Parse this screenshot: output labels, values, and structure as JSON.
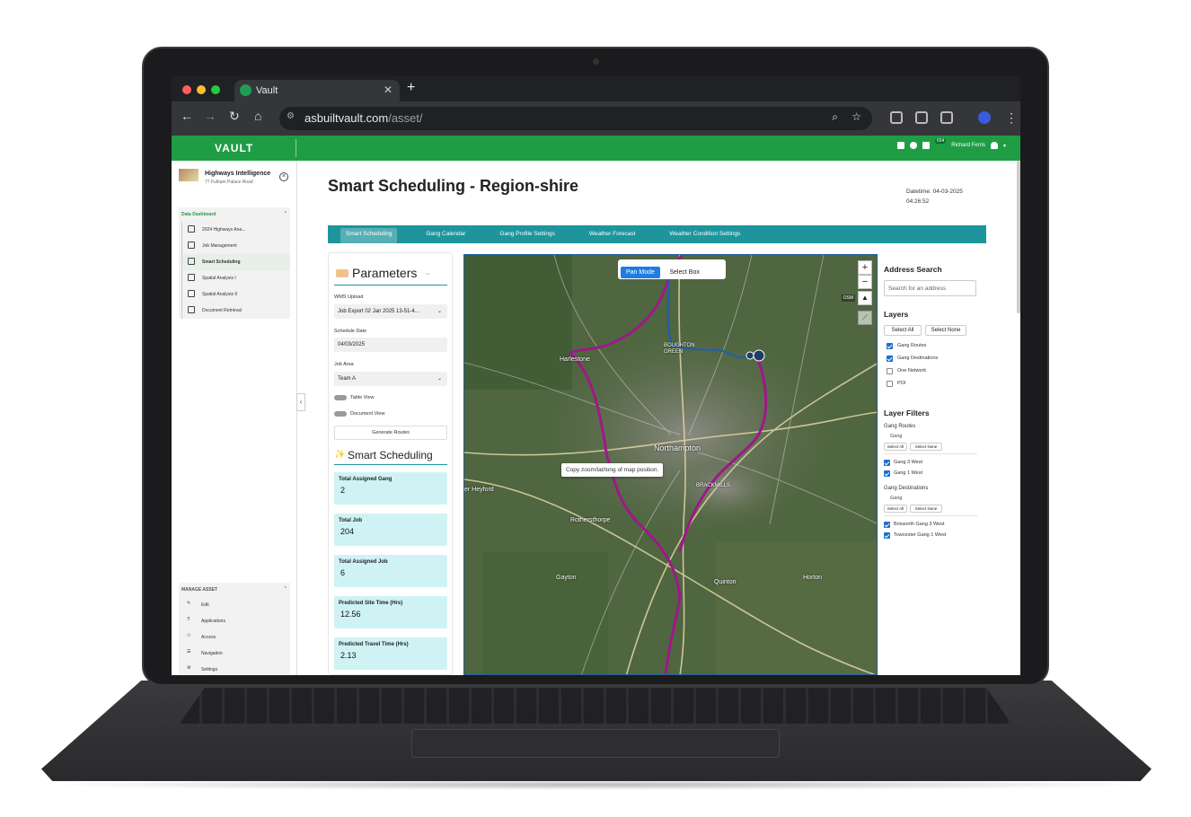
{
  "browser": {
    "tab_title": "Vault",
    "url_host": "asbuiltvault.com",
    "url_path": "/asset/",
    "new_tab_symbol": "+",
    "close_symbol": "✕"
  },
  "app": {
    "logo": "VAULT",
    "notification_count": "654",
    "user_name": "Richard Ferris"
  },
  "sidebar": {
    "project_title": "Highways Intelligence",
    "project_address": "77 Fulham Palace Road",
    "section1": "Data Dashboard",
    "items": [
      {
        "label": "2024 Highways Ana..."
      },
      {
        "label": "Job Management"
      },
      {
        "label": "Smart Scheduling"
      },
      {
        "label": "Spatial Analysis I"
      },
      {
        "label": "Spatial Analysis II"
      },
      {
        "label": "Document Retrieval"
      }
    ],
    "section2": "MANAGE ASSET",
    "manage_items": [
      {
        "label": "Edit"
      },
      {
        "label": "Applications"
      },
      {
        "label": "Access"
      },
      {
        "label": "Navigation"
      },
      {
        "label": "Settings"
      }
    ]
  },
  "main": {
    "title": "Smart Scheduling - Region-shire",
    "datetime_label": "Datetime: 04-03-2025",
    "datetime_time": "04:26:52",
    "tabs": [
      "Smart Scheduling",
      "Gang Calendar",
      "Gang Profile Settings",
      "Weather Forecast",
      "Weather Condition Settings"
    ]
  },
  "params": {
    "title": "Parameters",
    "wms_label": "WMS Upload",
    "wms_value": "Job Export 02 Jan 2025 13-51-4...",
    "date_label": "Schedule Date",
    "date_value": "04/03/2025",
    "area_label": "Job Area",
    "area_value": "Team A",
    "table_view": "Table View",
    "document_view": "Document View",
    "generate": "Generate Routes",
    "ss_title": "Smart Scheduling",
    "cards": [
      {
        "title": "Total Assigned Gang",
        "value": "2"
      },
      {
        "title": "Total Job",
        "value": "204"
      },
      {
        "title": "Total Assigned Job",
        "value": "6"
      },
      {
        "title": "Predicted Site Time (Hrs)",
        "value": "12.56"
      },
      {
        "title": "Predicted Travel Time (Hrs)",
        "value": "2.13"
      }
    ]
  },
  "map": {
    "pan_mode": "Pan Mode",
    "select_box": "Select Box",
    "tooltip": "Copy zoom/lat/long of map position.",
    "zoom_in": "+",
    "zoom_out": "−",
    "osm_label": "OSM",
    "labels": [
      "Northampton",
      "Harlestone",
      "BOUGHTON GREEN",
      "Rothersthorpe",
      "Gayton",
      "Quinton",
      "Horton",
      "er Heyford",
      "BRACKMILLS"
    ]
  },
  "right_panel": {
    "address_title": "Address Search",
    "address_placeholder": "Search for an address",
    "layers_title": "Layers",
    "select_all": "Select All",
    "select_none": "Select None",
    "layers": [
      {
        "label": "Gang Routes",
        "checked": true
      },
      {
        "label": "Gang Destinations",
        "checked": true
      },
      {
        "label": "One Network",
        "checked": false
      },
      {
        "label": "POI",
        "checked": false
      }
    ],
    "filters_title": "Layer Filters",
    "gang_routes": "Gang Routes",
    "gang": "Gang",
    "routes_items": [
      {
        "label": "Gang 3 West",
        "checked": true
      },
      {
        "label": "Gang 1 West",
        "checked": true
      }
    ],
    "gang_destinations": "Gang Destinations",
    "dest_items": [
      {
        "label": "Brixworth Gang 3 West",
        "checked": true
      },
      {
        "label": "Towcester Gang 1 West",
        "checked": true
      }
    ]
  }
}
